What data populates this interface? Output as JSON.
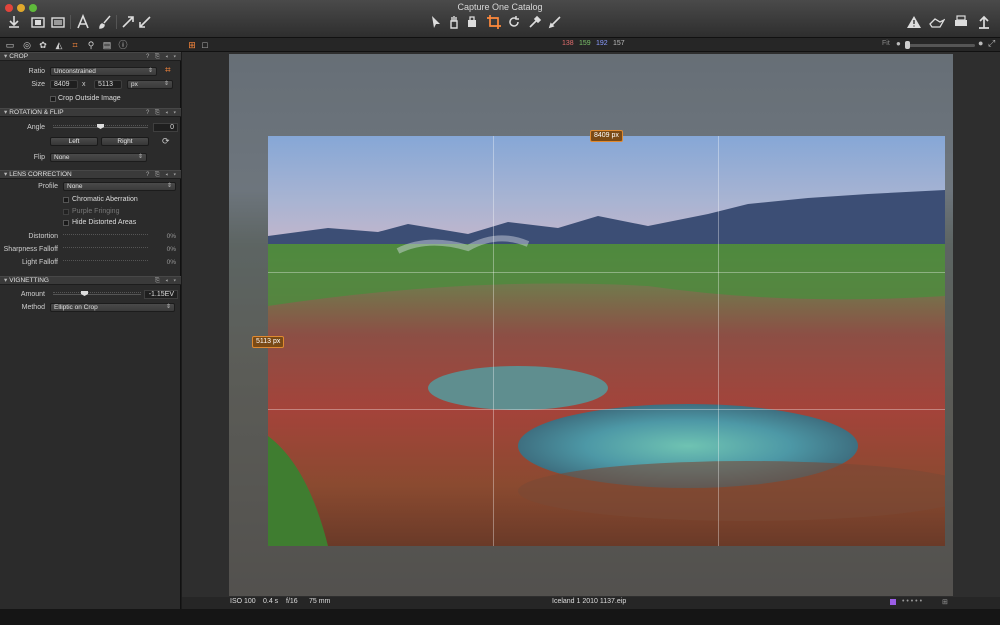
{
  "window": {
    "title": "Capture One Catalog"
  },
  "toolbar": {
    "left_icons": [
      "import-icon",
      "capture-icon",
      "browser-icon",
      "text-tool-icon",
      "brush-icon",
      "pick-icon",
      "apply-icon"
    ],
    "center_icons": [
      "select-cursor-icon",
      "hand-pan-icon",
      "loupe-icon",
      "crop-icon",
      "rotate-icon",
      "color-picker-icon",
      "local-adjust-icon"
    ],
    "right_icons": [
      "warning-icon",
      "compare-icon",
      "print-icon",
      "export-icon"
    ]
  },
  "subbar": {
    "tool_tabs": [
      "library-tab",
      "capture-tab",
      "color-tab",
      "exposure-tab",
      "composition-tab",
      "details-tab",
      "metadata-tab",
      "info-tab"
    ],
    "rgb": {
      "r": "138",
      "g": "159",
      "b": "192",
      "l": "157"
    },
    "fit_label": "Fit"
  },
  "crop": {
    "title": "CROP",
    "ratio_label": "Ratio",
    "ratio_value": "Unconstrained",
    "size_label": "Size",
    "width": "8409",
    "x_label": "x",
    "height": "5113",
    "unit": "px",
    "crop_outside_label": "Crop Outside Image"
  },
  "rotation": {
    "title": "ROTATION & FLIP",
    "angle_label": "Angle",
    "angle_value": "0",
    "left_button": "Left",
    "right_button": "Right",
    "flip_label": "Flip",
    "flip_value": "None"
  },
  "lens": {
    "title": "LENS CORRECTION",
    "profile_label": "Profile",
    "profile_value": "None",
    "chromatic_label": "Chromatic Aberration",
    "purple_label": "Purple Fringing",
    "hide_distorted_label": "Hide Distorted Areas",
    "distortion_label": "Distortion",
    "distortion_value": "0%",
    "sharpness_label": "Sharpness Falloff",
    "sharpness_value": "0%",
    "light_label": "Light Falloff",
    "light_value": "0%"
  },
  "vignetting": {
    "title": "VIGNETTING",
    "amount_label": "Amount",
    "amount_value": "-1.15EV",
    "method_label": "Method",
    "method_value": "Elliptic on Crop"
  },
  "viewer": {
    "width_tag": "8409 px",
    "height_tag": "5113 px"
  },
  "status": {
    "iso": "ISO 100",
    "shutter": "0.4 s",
    "aperture": "f/16",
    "focal": "75 mm",
    "filename": "Iceland 1 2010 1137.eip"
  },
  "colors": {
    "accent": "#ff8a3c",
    "rgb_r": "#e26d6d",
    "rgb_g": "#7bc46b",
    "rgb_b": "#8a9cff",
    "rgb_l": "#bbbbbb"
  }
}
